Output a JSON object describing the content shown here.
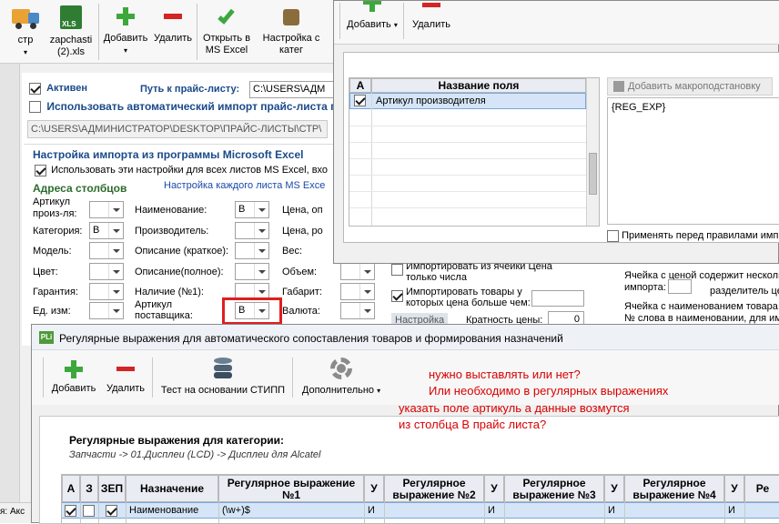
{
  "main_toolbar": {
    "btn_ctp": "стр",
    "btn_zapchasti_line1": "zapchasti",
    "btn_zapchasti_line2": "(2).xls",
    "btn_add": "Добавить",
    "btn_delete": "Удалить",
    "btn_open_line1": "Открыть в",
    "btn_open_line2": "MS Excel",
    "btn_settings_line1": "Настройка с",
    "btn_settings_line2": "катег"
  },
  "import_panel": {
    "active_label": "Активен",
    "path_label": "Путь к прайс-листу:",
    "path_value": "C:\\USERS\\АДМ",
    "auto_import_label": "Использовать автоматический импорт прайс-листа п",
    "folder_path": "C:\\USERS\\АДМИНИСТРАТОР\\DESKTOP\\ПРАЙС-ЛИСТЫ\\СТР\\",
    "excel_section_title": "Настройка импорта из программы Microsoft Excel",
    "use_all_sheets_label": "Использовать эти настройки для всех листов MS Excel, вхо",
    "columns_title": "Адреса столбцов",
    "per_sheet_link": "Настройка каждого листа MS Exce",
    "fields": {
      "article_mfr": "Артикул произ-ля:",
      "category": "Категория:",
      "model": "Модель:",
      "color": "Цвет:",
      "warranty": "Гарантия:",
      "unit": "Ед. изм:",
      "name": "Наименование:",
      "manufacturer": "Производитель:",
      "desc_short": "Описание (краткое):",
      "desc_full": "Описание(полное):",
      "availability": "Наличие (№1):",
      "article_supplier_l1": "Артикул",
      "article_supplier_l2": "поставщика:",
      "price": "Цена, оп",
      "price_r": "Цена, ро",
      "weight": "Вес:",
      "volume": "Объем:",
      "dims": "Габарит:",
      "currency": "Валюта:"
    },
    "values": {
      "category": "B",
      "name": "B",
      "article_supplier": "B"
    },
    "import_cell_l1": "Импортировать из ячейки  Цена",
    "import_cell_l2": "только числа",
    "import_gt_l1": "Импортировать товары у",
    "import_gt_l2": "которых цена больше чем:",
    "setup_tab": "Настройка",
    "multiplicity_label": "Кратность цены:",
    "multiplicity_value": "0",
    "right_note1": "Ячейка с ценой содержит несколь",
    "right_note2": "импорта:",
    "right_note3": "разделитель цен",
    "right_note4": "Ячейка с наименованием товара с",
    "right_note5": "№ слова в наименовании, для им"
  },
  "field_dialog": {
    "btn_add": "Добавить",
    "btn_delete": "Удалить",
    "col_a": "А",
    "col_name": "Название поля",
    "row1": "Артикул производителя",
    "macro_btn": "Добавить макроподстановку",
    "macro_text": "{REG_EXP}",
    "apply_before": "Применять перед правилами импор"
  },
  "regex_window": {
    "title": "Регулярные выражения для автоматического сопоставления товаров и формирования назначений",
    "app_icon": "PLi",
    "btn_add": "Добавить",
    "btn_delete": "Удалить",
    "btn_test": "Тест на основании СТИПП",
    "btn_more": "Дополнительно",
    "annotation_l1": "нужно выставлять или нет?",
    "annotation_l2": "Или необходимо в регулярных выражениях",
    "annotation_l3": "указать поле артикуль а данные возмутся",
    "annotation_l4": "из столбца В прайс листа?",
    "category_label": "Регулярные выражения для категории:",
    "breadcrumb": "Запчасти -> 01.Дисплеи (LCD) -> Дисплеи для Alcatel",
    "headers": {
      "a": "А",
      "z": "З",
      "zep": "ЗЕП",
      "purpose": "Назначение",
      "re1_l1": "Регулярное выражение",
      "re1_l2": "№1",
      "u": "У",
      "re2_l1": "Регулярное",
      "re2_l2": "выражение №2",
      "re3_l1": "Регулярное",
      "re3_l2": "выражение №3",
      "re4_l1": "Регулярное",
      "re4_l2": "выражение №4",
      "re5": "Ре"
    },
    "row": {
      "purpose": "Наименование",
      "re1": "(\\w+)$",
      "u1": "И",
      "u2": "И",
      "u3": "И",
      "u4": "И"
    }
  },
  "taskbar_left": "я: Акс"
}
